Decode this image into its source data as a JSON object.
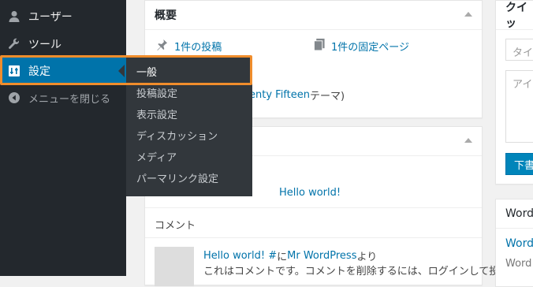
{
  "sidebar": {
    "items": [
      {
        "label": "ユーザー",
        "icon": "user-icon"
      },
      {
        "label": "ツール",
        "icon": "wrench-icon"
      },
      {
        "label": "設定",
        "icon": "settings-icon"
      },
      {
        "label": "メニューを閉じる",
        "icon": "collapse-icon"
      }
    ],
    "flyout": [
      "一般",
      "投稿設定",
      "表示設定",
      "ディスカッション",
      "メディア",
      "パーマリンク設定"
    ]
  },
  "overview": {
    "title": "概要",
    "posts": "1件の投稿",
    "pages": "1件の固定ページ",
    "theme_link": "enty Fifteen",
    "theme_suffix": " テーマ)"
  },
  "activity": {
    "recent_post": "Hello world!",
    "comment_heading": "コメント",
    "comment_post": "Hello world! #",
    "comment_mid": " に ",
    "comment_author": "Mr WordPress",
    "comment_after": " より",
    "comment_text": "これはコメントです。コメントを削除するには、ログインして投稿"
  },
  "quick_draft": {
    "title": "クイッ",
    "title_placeholder": "タイト",
    "content_placeholder": "アイデ",
    "button": "下書"
  },
  "news": {
    "title": "Word",
    "link": "Word",
    "text": "Word"
  },
  "colors": {
    "sidebar_bg": "#23282d",
    "flyout_bg": "#32373c",
    "accent": "#0073aa",
    "highlight_border": "#f08d2c"
  }
}
